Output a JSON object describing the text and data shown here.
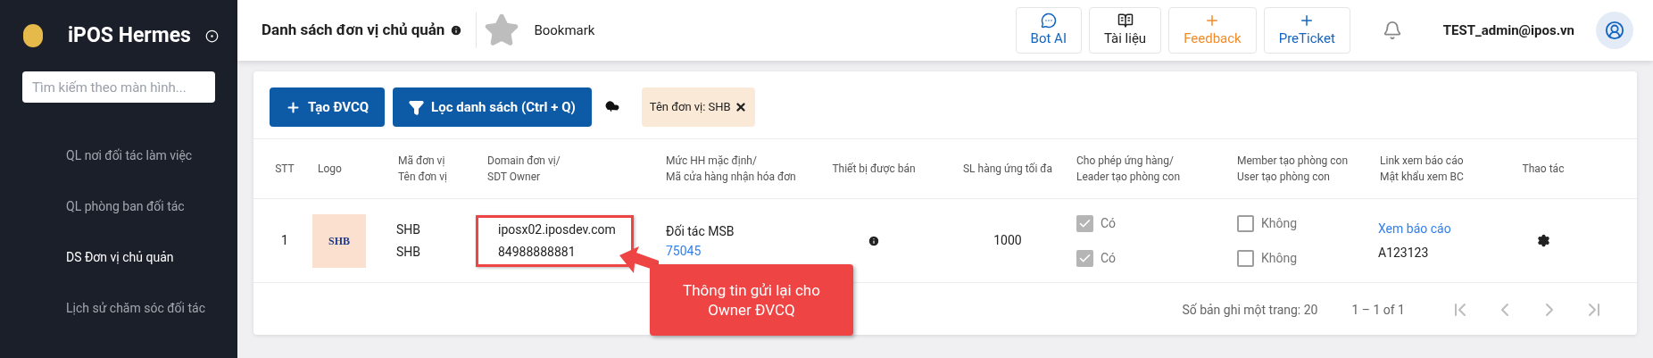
{
  "sidebar": {
    "app_name": "iPOS Hermes",
    "search": {
      "placeholder": "Tìm kiếm theo màn hình..."
    },
    "items": [
      {
        "label": "QL nơi đối tác làm việc",
        "selected": false
      },
      {
        "label": "QL phòng ban đối tác",
        "selected": false
      },
      {
        "label": "DS Đơn vị chủ quản",
        "selected": true
      },
      {
        "label": "Lịch sử chăm sóc đối tác",
        "selected": false
      }
    ]
  },
  "header": {
    "title": "Danh sách đơn vị chủ quản",
    "bookmark": "Bookmark",
    "buttons": [
      {
        "kind": "chat",
        "label": "Bot AI"
      },
      {
        "kind": "docs",
        "label": "Tài liệu"
      },
      {
        "kind": "feedback",
        "label": "Feedback"
      },
      {
        "kind": "ticket",
        "label": "PreTicket"
      }
    ],
    "user": "TEST_admin@ipos.vn"
  },
  "toolbar": {
    "buttons": [
      {
        "kind": "add",
        "label": "Tạo ĐVCQ"
      },
      {
        "kind": "filter",
        "label": "Lọc danh sách (Ctrl + Q)"
      }
    ],
    "filter_chip": "Tên đơn vị: SHB"
  },
  "table": {
    "columns": [
      [
        "STT"
      ],
      [
        "Logo"
      ],
      [
        "Mã đơn vị",
        "Tên đơn vị"
      ],
      [
        "Domain đơn vị/",
        "SDT Owner"
      ],
      [
        "Mức HH mặc định/",
        "Mã cửa hàng nhận hóa đơn"
      ],
      [
        "Thiết bị được bán"
      ],
      [
        "SL hàng ứng tối đa"
      ],
      [
        "Cho phép ứng hàng/",
        "Leader tạo phòng con"
      ],
      [
        "Member tạo phòng con",
        "User tạo phòng con"
      ],
      [
        "Link xem báo cáo",
        "Mật khẩu xem BC"
      ],
      [
        "Thao tác"
      ]
    ],
    "rows": [
      {
        "stt": "1",
        "logo": "SHB",
        "code": "SHB",
        "name": "SHB",
        "domain": "iposx02.iposdev.com",
        "phone": "84988888881",
        "commission": "Đối tác MSB",
        "store_code": "75045",
        "max_qty": "1000",
        "allow_advance": {
          "label": "Có",
          "checked": true
        },
        "leader_create": {
          "label": "Có",
          "checked": true
        },
        "member_create": {
          "label": "Không",
          "checked": false
        },
        "user_create": {
          "label": "Không",
          "checked": false
        },
        "report_link": "Xem báo cáo",
        "report_password": "A123123"
      }
    ]
  },
  "pagination": {
    "page_size": "Số bản ghi một trang: 20",
    "range": "1 – 1 of 1"
  },
  "callout": {
    "text": "Thông tin gửi lại cho Owner ĐVCQ"
  }
}
